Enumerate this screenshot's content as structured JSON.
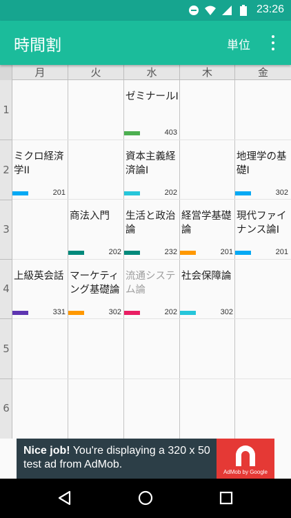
{
  "status_bar": {
    "time": "23:26",
    "icons": [
      "dnd-icon",
      "wifi-icon",
      "signal-icon",
      "battery-icon"
    ]
  },
  "app_bar": {
    "title": "時間割",
    "unit_button": "単位",
    "more_icon": "more-vert-icon"
  },
  "timetable": {
    "days": [
      "月",
      "火",
      "水",
      "木",
      "金"
    ],
    "periods": [
      "1",
      "2",
      "3",
      "4",
      "5",
      "6"
    ],
    "classes": [
      {
        "day": 2,
        "period": 1,
        "name": "ゼミナールI",
        "room": "403",
        "color": "#4caf50",
        "dim": false
      },
      {
        "day": 0,
        "period": 2,
        "name": "ミクロ経済学II",
        "room": "201",
        "color": "#03a9f4",
        "dim": false
      },
      {
        "day": 2,
        "period": 2,
        "name": "資本主義経済論I",
        "room": "202",
        "color": "#26c6da",
        "dim": false
      },
      {
        "day": 4,
        "period": 2,
        "name": "地理学の基礎I",
        "room": "302",
        "color": "#03a9f4",
        "dim": false
      },
      {
        "day": 1,
        "period": 3,
        "name": "商法入門",
        "room": "202",
        "color": "#00897b",
        "dim": false
      },
      {
        "day": 2,
        "period": 3,
        "name": "生活と政治論",
        "room": "232",
        "color": "#00897b",
        "dim": false
      },
      {
        "day": 3,
        "period": 3,
        "name": "経営学基礎論",
        "room": "201",
        "color": "#ff9800",
        "dim": false
      },
      {
        "day": 4,
        "period": 3,
        "name": "現代ファイナンス論I",
        "room": "201",
        "color": "#03a9f4",
        "dim": false
      },
      {
        "day": 0,
        "period": 4,
        "name": "上級英会話",
        "room": "331",
        "color": "#5e35b1",
        "dim": false
      },
      {
        "day": 1,
        "period": 4,
        "name": "マーケティング基礎論",
        "room": "302",
        "color": "#ff9800",
        "dim": false
      },
      {
        "day": 2,
        "period": 4,
        "name": "流通システム論",
        "room": "202",
        "color": "#e91e63",
        "dim": true
      },
      {
        "day": 3,
        "period": 4,
        "name": "社会保障論",
        "room": "302",
        "color": "#26c6da",
        "dim": false
      }
    ]
  },
  "ad": {
    "headline": "Nice job!",
    "body": " You're displaying a 320 x 50 test ad from AdMob.",
    "brand": "AdMob by Google",
    "logo_color": "#e53935"
  },
  "nav_bar": {
    "icons": [
      "back-icon",
      "home-icon",
      "recents-icon"
    ]
  }
}
